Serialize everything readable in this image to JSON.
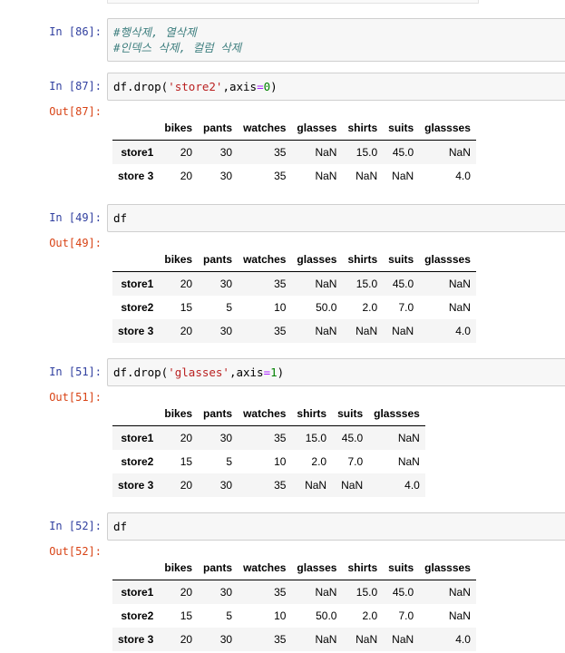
{
  "cells": [
    {
      "in": "In [86]:",
      "code_lines": [
        "#행삭제, 열삭제",
        "#인덱스 삭제, 컬럼 삭제"
      ]
    },
    {
      "in": "In [87]:",
      "code": {
        "pre": "df.drop(",
        "str": "'store2'",
        "mid": ",axis",
        "op": "=",
        "num": "0",
        "post": ")"
      },
      "out": "Out[87]:",
      "columns": [
        "bikes",
        "pants",
        "watches",
        "glasses",
        "shirts",
        "suits",
        "glassses"
      ],
      "rows": [
        {
          "index": "store1",
          "values": [
            "20",
            "30",
            "35",
            "NaN",
            "15.0",
            "45.0",
            "NaN"
          ]
        },
        {
          "index": "store 3",
          "values": [
            "20",
            "30",
            "35",
            "NaN",
            "NaN",
            "NaN",
            "4.0"
          ]
        }
      ]
    },
    {
      "in": "In [49]:",
      "code_plain": "df",
      "out": "Out[49]:",
      "columns": [
        "bikes",
        "pants",
        "watches",
        "glasses",
        "shirts",
        "suits",
        "glassses"
      ],
      "rows": [
        {
          "index": "store1",
          "values": [
            "20",
            "30",
            "35",
            "NaN",
            "15.0",
            "45.0",
            "NaN"
          ]
        },
        {
          "index": "store2",
          "values": [
            "15",
            "5",
            "10",
            "50.0",
            "2.0",
            "7.0",
            "NaN"
          ]
        },
        {
          "index": "store 3",
          "values": [
            "20",
            "30",
            "35",
            "NaN",
            "NaN",
            "NaN",
            "4.0"
          ]
        }
      ]
    },
    {
      "in": "In [51]:",
      "code": {
        "pre": "df.drop(",
        "str": "'glasses'",
        "mid": ",axis",
        "op": "=",
        "num": "1",
        "post": ")"
      },
      "out": "Out[51]:",
      "columns": [
        "bikes",
        "pants",
        "watches",
        "shirts",
        "suits",
        "glassses"
      ],
      "rows": [
        {
          "index": "store1",
          "values": [
            "20",
            "30",
            "35",
            "15.0",
            "45.0",
            "NaN"
          ]
        },
        {
          "index": "store2",
          "values": [
            "15",
            "5",
            "10",
            "2.0",
            "7.0",
            "NaN"
          ]
        },
        {
          "index": "store 3",
          "values": [
            "20",
            "30",
            "35",
            "NaN",
            "NaN",
            "4.0"
          ]
        }
      ]
    },
    {
      "in": "In [52]:",
      "code_plain": "df",
      "out": "Out[52]:",
      "columns": [
        "bikes",
        "pants",
        "watches",
        "glasses",
        "shirts",
        "suits",
        "glassses"
      ],
      "rows": [
        {
          "index": "store1",
          "values": [
            "20",
            "30",
            "35",
            "NaN",
            "15.0",
            "45.0",
            "NaN"
          ]
        },
        {
          "index": "store2",
          "values": [
            "15",
            "5",
            "10",
            "50.0",
            "2.0",
            "7.0",
            "NaN"
          ]
        },
        {
          "index": "store 3",
          "values": [
            "20",
            "30",
            "35",
            "NaN",
            "NaN",
            "NaN",
            "4.0"
          ]
        }
      ]
    }
  ]
}
